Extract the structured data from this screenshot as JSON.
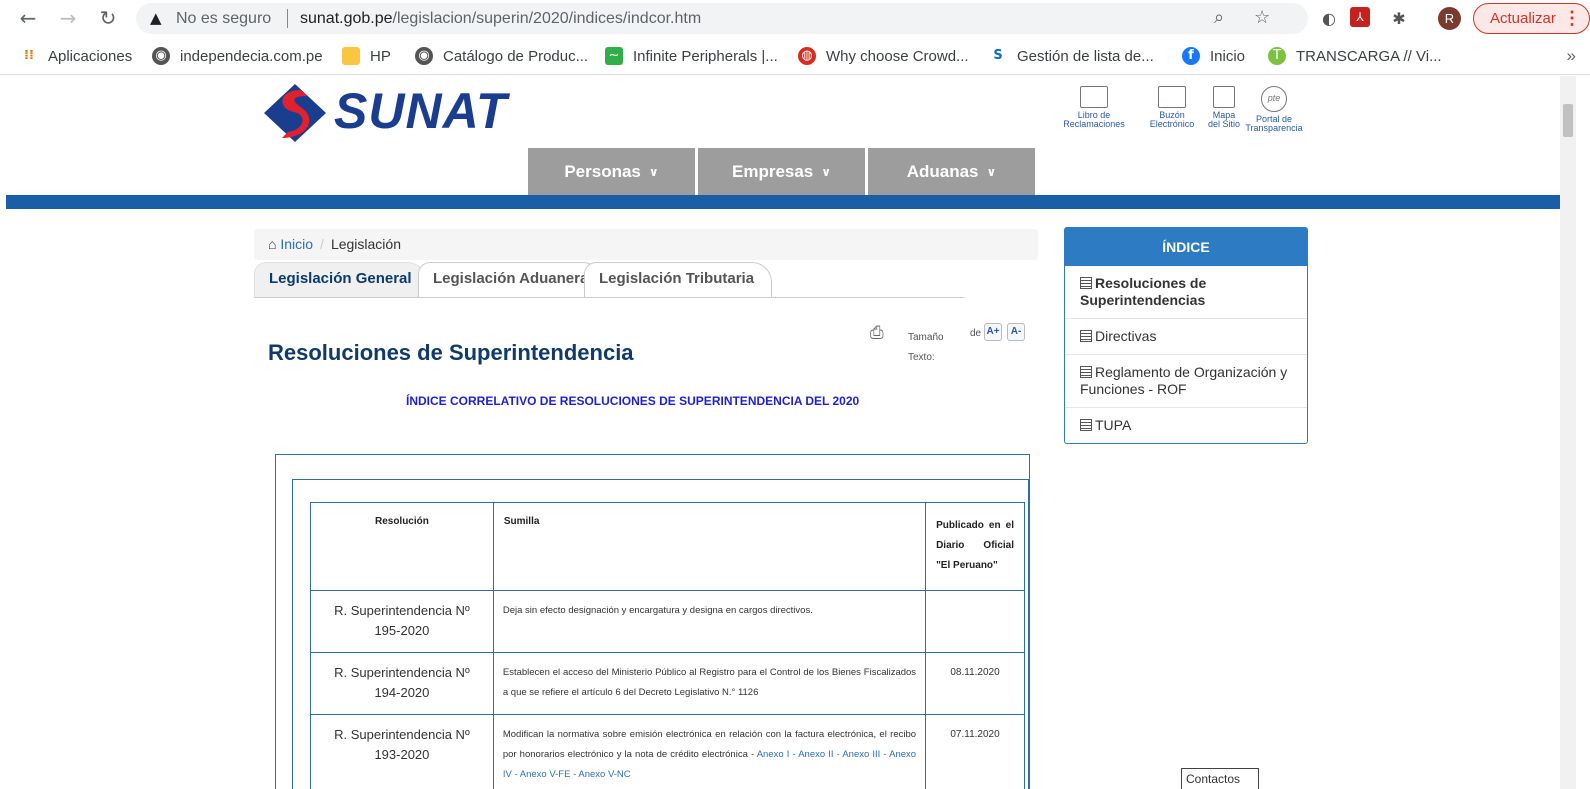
{
  "browser": {
    "security_label": "No es seguro",
    "url_host": "sunat.gob.pe",
    "url_path": "/legislacion/superin/2020/indices/indcor.htm",
    "profile_initial": "R",
    "update_label": "Actualizar"
  },
  "bookmarks": [
    {
      "label": "Aplicaciones",
      "icon": "apps-grid-icon"
    },
    {
      "label": "independecia.com.pe",
      "icon": "globe-icon"
    },
    {
      "label": "HP",
      "icon": "folder-icon"
    },
    {
      "label": "Catálogo de Produc...",
      "icon": "globe-icon"
    },
    {
      "label": "Infinite Peripherals |...",
      "icon": "wave-icon"
    },
    {
      "label": "Why choose Crowd...",
      "icon": "crowd-icon"
    },
    {
      "label": "Gestión de lista de...",
      "icon": "sharepoint-icon"
    },
    {
      "label": "Inicio",
      "icon": "facebook-icon"
    },
    {
      "label": "TRANSCARGA // Vi...",
      "icon": "transcarga-icon"
    }
  ],
  "site": {
    "logo_text": "SUNAT",
    "top_links": [
      {
        "line1": "Libro de",
        "line2": "Reclamaciones"
      },
      {
        "line1": "Buzón",
        "line2": "Electrónico"
      },
      {
        "line1": "Mapa",
        "line2": "del Sitio"
      },
      {
        "line1": "Portal de",
        "line2": "Transparencia"
      }
    ],
    "main_nav": [
      "Personas",
      "Empresas",
      "Aduanas"
    ],
    "breadcrumb": {
      "home": "Inicio",
      "current": "Legislación"
    },
    "tabs": [
      "Legislación General",
      "Legislación Aduanera",
      "Legislación Tributaria"
    ],
    "title": "Resoluciones de Superintendencia",
    "text_size_label_1": "Tamaño",
    "text_size_label_2": "de",
    "text_size_label_3": "Texto:",
    "font_up": "A+",
    "font_down": "A-",
    "subheading": "ÍNDICE CORRELATIVO DE RESOLUCIONES DE SUPERINTENDENCIA DEL 2020"
  },
  "table": {
    "headers": [
      "Resolución",
      "Sumilla",
      "Publicado en el Diario Oficial \"El Peruano\""
    ],
    "rows": [
      {
        "res_1": "R. Superintendencia Nº",
        "res_2": "195-2020",
        "sumilla": "Deja sin efecto designación y encargatura y designa en cargos directivos.",
        "annexes": "",
        "date": ""
      },
      {
        "res_1": "R. Superintendencia Nº",
        "res_2": "194-2020",
        "sumilla": "Establecen el acceso del Ministerio Público al Registro para el Control de los Bienes Fiscalizados a que se refiere el artículo 6 del Decreto Legislativo N.° 1126",
        "annexes": "",
        "date": "08.11.2020"
      },
      {
        "res_1": "R. Superintendencia Nº",
        "res_2": "193-2020",
        "sumilla": "Modifican la normativa sobre emisión electrónica en relación con la factura electrónica, el recibo por honorarios electrónico y la nota de crédito electrónica - ",
        "annexes": "Anexo I - Anexo II - Anexo III - Anexo IV - Anexo V-FE - Anexo V-NC",
        "date": "07.11.2020"
      }
    ]
  },
  "sidebar": {
    "title": "ÍNDICE",
    "items": [
      "Resoluciones de Superintendencias",
      "Directivas",
      "Reglamento de Organización y Funciones - ROF",
      "TUPA"
    ]
  },
  "contact_label": "Contactos"
}
